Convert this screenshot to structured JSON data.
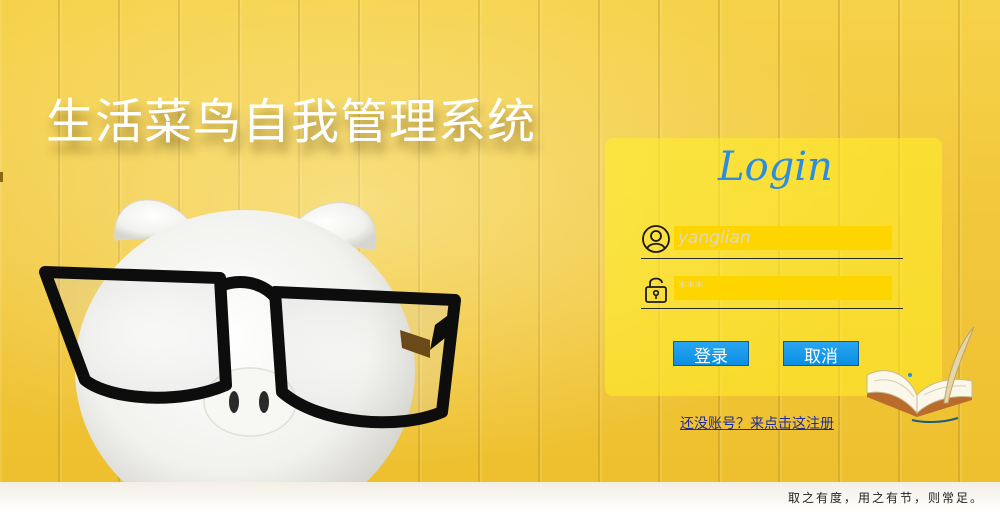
{
  "page": {
    "title": "生活菜鸟自我管理系统",
    "motto": "取之有度，用之有节，则常足。"
  },
  "login": {
    "heading": "Login",
    "username_placeholder": "yanglian",
    "password_placeholder": "***",
    "login_button": "登录",
    "cancel_button": "取消",
    "register_link": "还没账号？来点击这注册"
  },
  "icons": {
    "user": "user-icon",
    "lock": "lock-icon",
    "piggy_bank": "piggy-bank-illustration",
    "book": "book-quill-icon"
  },
  "colors": {
    "background": "#f1c73a",
    "panel": "#ffee28",
    "input_fill": "#ffd500",
    "button": "#0a8fe4",
    "heading": "#2a8de0",
    "link": "#1f2b9a"
  }
}
